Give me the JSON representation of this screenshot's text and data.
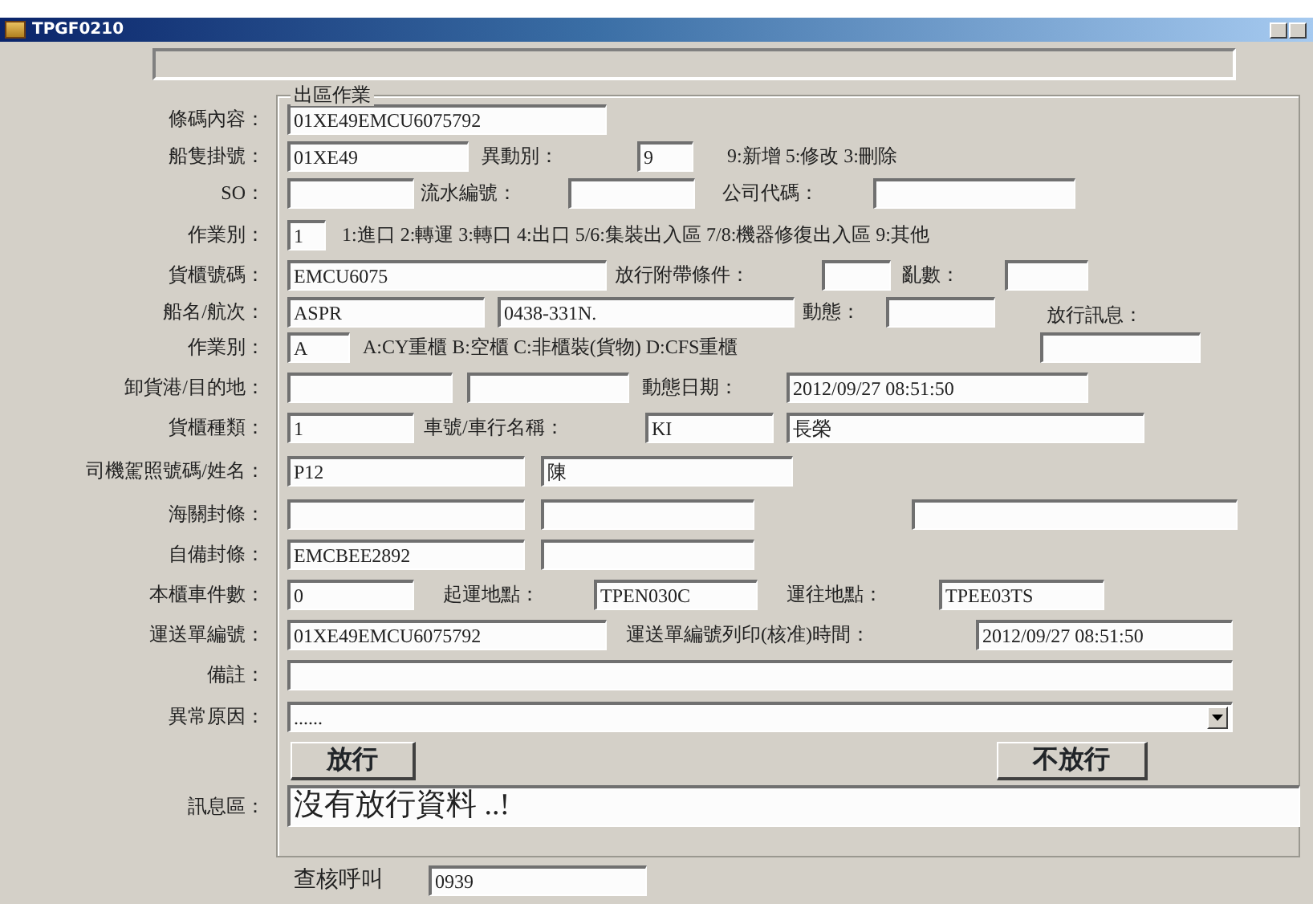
{
  "window": {
    "title": "TPGF0210"
  },
  "group": {
    "title": "出區作業",
    "rows": [
      {
        "items": [
          {
            "kind": "label",
            "text": "條碼內容："
          },
          {
            "kind": "field",
            "value": "01XE49EMCU6075792"
          }
        ]
      },
      {
        "items": [
          {
            "kind": "label",
            "text": "船隻掛號："
          },
          {
            "kind": "field",
            "value": "01XE49"
          },
          {
            "kind": "label",
            "text": "異動別："
          },
          {
            "kind": "field",
            "value": "9"
          },
          {
            "kind": "hint",
            "text": "9:新增 5:修改 3:刪除"
          }
        ]
      },
      {
        "items": [
          {
            "kind": "label",
            "text": "SO："
          },
          {
            "kind": "field"
          },
          {
            "kind": "label",
            "text": "流水編號："
          },
          {
            "kind": "field"
          },
          {
            "kind": "label",
            "text": "公司代碼："
          },
          {
            "kind": "field"
          }
        ]
      },
      {
        "items": [
          {
            "kind": "label",
            "text": "作業別："
          },
          {
            "kind": "field",
            "value": "1"
          },
          {
            "kind": "hint",
            "text": "1:進口 2:轉運 3:轉口 4:出口 5/6:集裝出入區 7/8:機器修復出入區 9:其他"
          }
        ]
      },
      {
        "items": [
          {
            "kind": "label",
            "text": "貨櫃號碼："
          },
          {
            "kind": "field",
            "value": "EMCU6075"
          },
          {
            "kind": "label",
            "text": "放行附帶條件："
          },
          {
            "kind": "field"
          },
          {
            "kind": "label",
            "text": "亂數："
          },
          {
            "kind": "field"
          }
        ]
      },
      {
        "items": [
          {
            "kind": "label",
            "text": "船名/航次："
          },
          {
            "kind": "field",
            "value": "ASPR"
          },
          {
            "kind": "field",
            "value": "0438-331N."
          },
          {
            "kind": "label",
            "text": "動態："
          },
          {
            "kind": "field"
          },
          {
            "kind": "label",
            "text": "放行訊息："
          }
        ]
      },
      {
        "items": [
          {
            "kind": "label",
            "text": "作業別："
          },
          {
            "kind": "field",
            "value": "A"
          },
          {
            "kind": "hint",
            "text": "A:CY重櫃 B:空櫃 C:非櫃裝(貨物) D:CFS重櫃"
          },
          {
            "kind": "field"
          }
        ]
      },
      {
        "items": [
          {
            "kind": "label",
            "text": "卸貨港/目的地："
          },
          {
            "kind": "field"
          },
          {
            "kind": "field"
          },
          {
            "kind": "label",
            "text": "動態日期："
          },
          {
            "kind": "field",
            "value": "2012/09/27 08:51:50"
          }
        ]
      },
      {
        "items": [
          {
            "kind": "label",
            "text": "貨櫃種類："
          },
          {
            "kind": "field",
            "value": "1"
          },
          {
            "kind": "label",
            "text": "車號/車行名稱："
          },
          {
            "kind": "field",
            "value": "KI"
          },
          {
            "kind": "field",
            "value": "長榮"
          }
        ]
      },
      {
        "items": [
          {
            "kind": "label",
            "text": "司機駕照號碼/姓名："
          },
          {
            "kind": "field",
            "value": "P12"
          },
          {
            "kind": "field",
            "value": "陳"
          }
        ]
      },
      {
        "items": [
          {
            "kind": "label",
            "text": "海關封條："
          },
          {
            "kind": "field"
          },
          {
            "kind": "field"
          },
          {
            "kind": "field"
          }
        ]
      },
      {
        "items": [
          {
            "kind": "label",
            "text": "自備封條："
          },
          {
            "kind": "field",
            "value": "EMCBEE2892"
          },
          {
            "kind": "field"
          }
        ]
      },
      {
        "items": [
          {
            "kind": "label",
            "text": "本櫃車件數："
          },
          {
            "kind": "field",
            "value": "0"
          },
          {
            "kind": "label",
            "text": "起運地點："
          },
          {
            "kind": "field",
            "value": "TPEN030C"
          },
          {
            "kind": "label",
            "text": "運往地點："
          },
          {
            "kind": "field",
            "value": "TPEE03TS"
          }
        ]
      },
      {
        "items": [
          {
            "kind": "label",
            "text": "運送單編號："
          },
          {
            "kind": "field",
            "value": "01XE49EMCU6075792"
          },
          {
            "kind": "label",
            "text": "運送單編號列印(核准)時間："
          },
          {
            "kind": "field",
            "value": "2012/09/27 08:51:50"
          }
        ]
      },
      {
        "items": [
          {
            "kind": "label",
            "text": "備註："
          },
          {
            "kind": "field"
          }
        ]
      },
      {
        "items": [
          {
            "kind": "label",
            "text": "異常原因："
          },
          {
            "kind": "dropdown",
            "value": "......"
          }
        ]
      },
      {
        "items": [
          {
            "kind": "button",
            "text": "放行"
          },
          {
            "kind": "button",
            "text": "不放行"
          }
        ]
      },
      {
        "items": [
          {
            "kind": "label",
            "text": "訊息區："
          },
          {
            "kind": "message",
            "value": "沒有放行資料 ..!"
          }
        ]
      }
    ]
  },
  "check_call": {
    "label": "查核呼叫",
    "value": "0939"
  }
}
